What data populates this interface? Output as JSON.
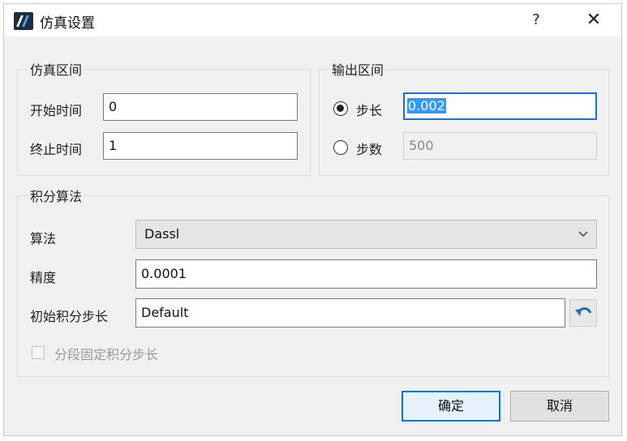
{
  "window": {
    "title": "仿真设置",
    "help_label": "?",
    "close_label": "✕"
  },
  "sim_interval": {
    "title": "仿真区间",
    "start_label": "开始时间",
    "start_value": "0",
    "end_label": "终止时间",
    "end_value": "1"
  },
  "output_interval": {
    "title": "输出区间",
    "step_size_label": "步长",
    "step_size_value": "0.002",
    "step_size_checked": true,
    "step_count_label": "步数",
    "step_count_value": "500",
    "step_count_checked": false
  },
  "integration": {
    "title": "积分算法",
    "algorithm_label": "算法",
    "algorithm_value": "Dassl",
    "precision_label": "精度",
    "precision_value": "0.0001",
    "initial_step_label": "初始积分步长",
    "initial_step_value": "Default",
    "fixed_step_label": "分段固定积分步长",
    "fixed_step_checked": false
  },
  "footer": {
    "ok_label": "确定",
    "cancel_label": "取消"
  },
  "colors": {
    "accent": "#1d6fd8",
    "selection": "#3399ff",
    "reset_icon": "#1e6fc0"
  }
}
